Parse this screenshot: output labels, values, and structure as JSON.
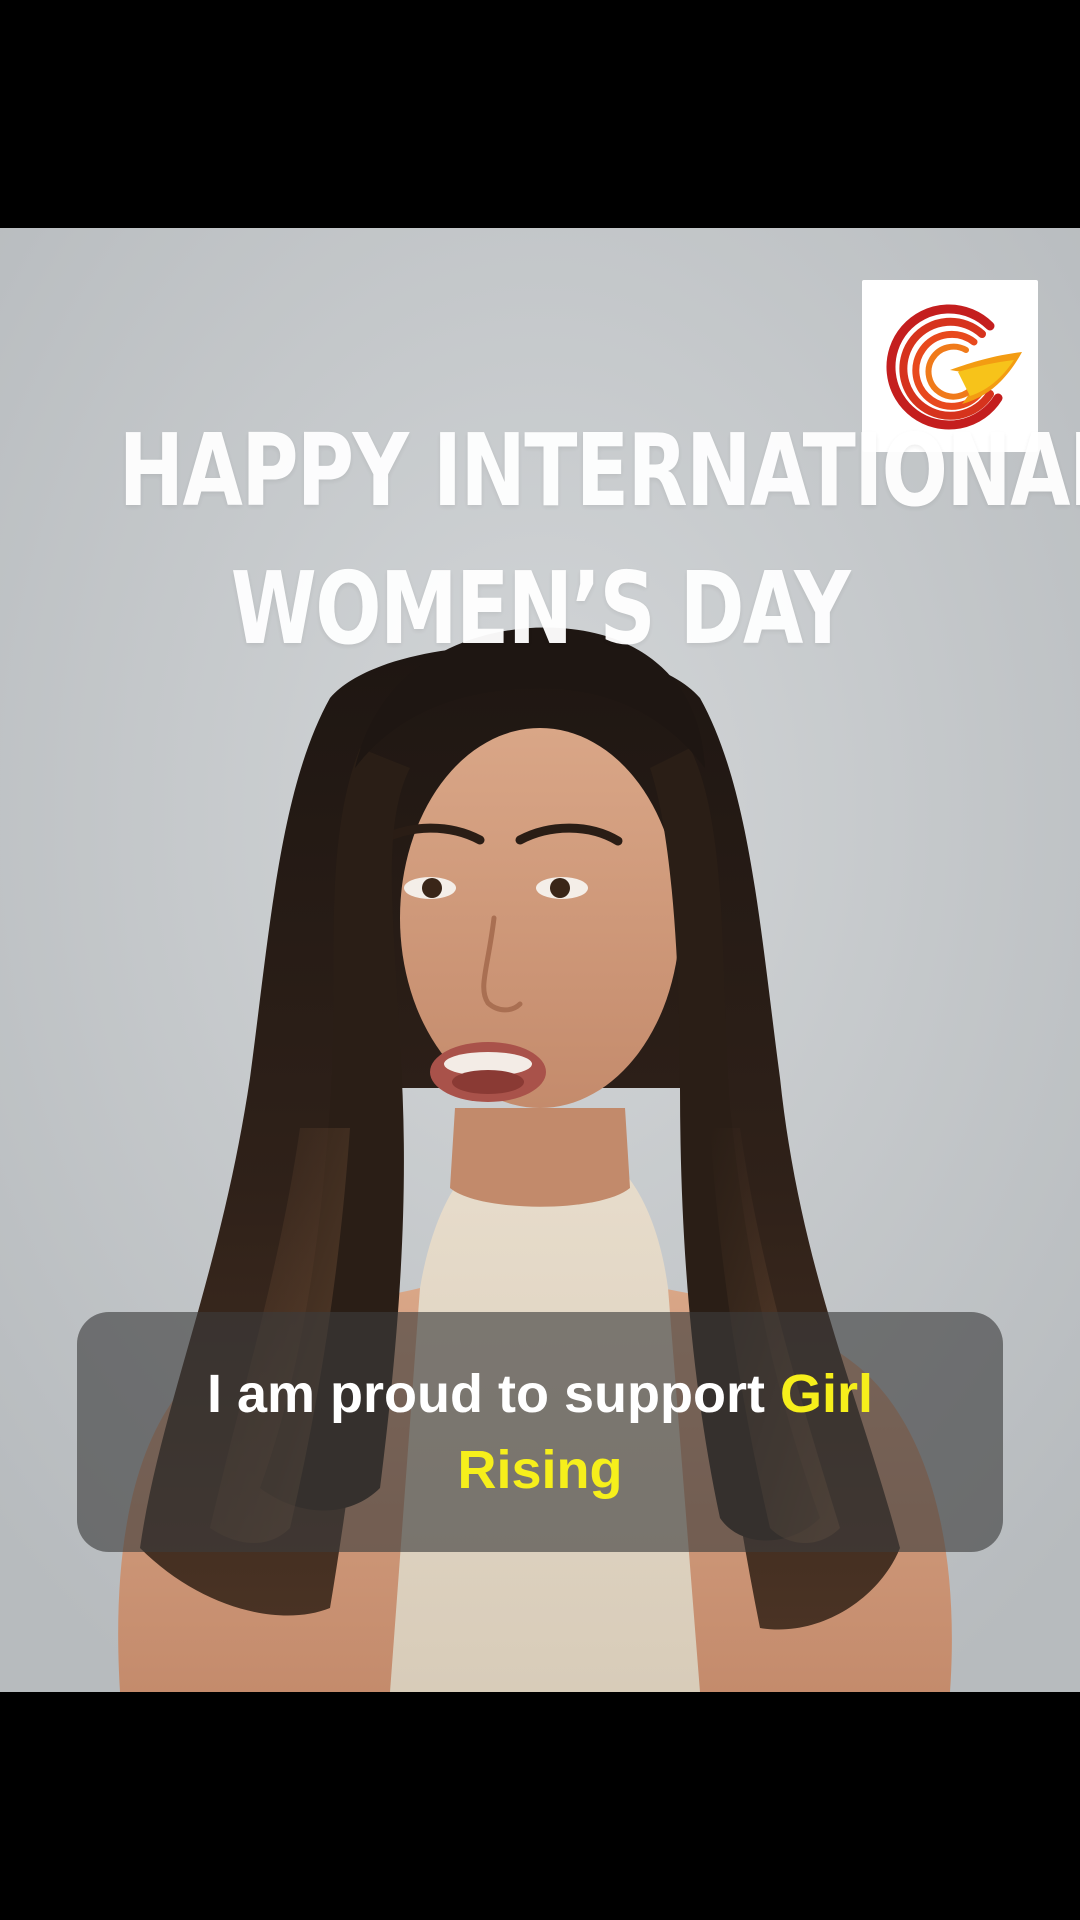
{
  "headline": {
    "line1": "HAPPY INTERNATIONAL",
    "line2": "WOMEN’S DAY"
  },
  "logo": {
    "icon": "girl-rising-g-logo-icon",
    "colors": [
      "#c41e1e",
      "#e8491d",
      "#f39c12",
      "#f7c31a"
    ]
  },
  "caption": {
    "text_plain": "I am proud to support",
    "text_highlight_1": "Girl",
    "text_highlight_2": "Rising",
    "highlight_color": "#f6ef1b"
  },
  "colors": {
    "letterbox": "#000000",
    "background_wall": "#c4c8cb",
    "caption_bg": "rgba(60,60,60,0.62)"
  }
}
